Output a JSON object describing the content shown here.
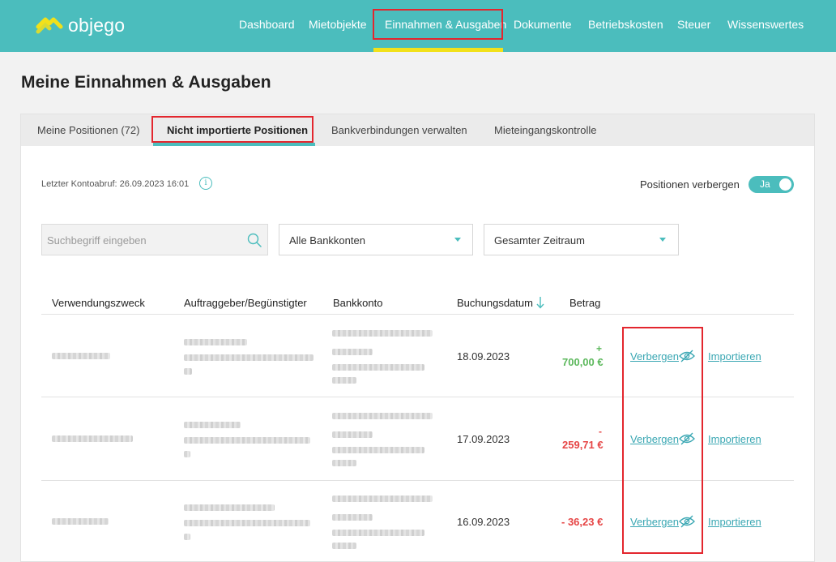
{
  "app": {
    "brand": "objego",
    "nav": [
      "Dashboard",
      "Mietobjekte",
      "Einnahmen & Ausgaben",
      "Dokumente",
      "Betriebskosten",
      "Steuer",
      "Wissenswertes"
    ],
    "active_nav": "Einnahmen & Ausgaben",
    "accent": "#4bbdbd",
    "highlight": "#f2e11a"
  },
  "page": {
    "title": "Meine Einnahmen & Ausgaben"
  },
  "tabs": [
    "Meine Positionen (72)",
    "Nicht importierte Positionen",
    "Bankverbindungen verwalten",
    "Mieteingangskontrolle"
  ],
  "toolbar": {
    "last_fetch": "Letzter Kontoabruf: 26.09.2023 16:01",
    "info_glyph": "i",
    "hide_label": "Positionen verbergen",
    "toggle_label": "Ja",
    "toggle_on": true
  },
  "filters": {
    "search_placeholder": "Suchbegriff eingeben",
    "bank_account": "Alle Bankkonten",
    "period": "Gesamter Zeitraum"
  },
  "table": {
    "headers": [
      "Verwendungszweck",
      "Auftraggeber/Begünstigter",
      "Bankkonto",
      "Buchungsdatum",
      "Betrag"
    ],
    "rows": [
      {
        "date": "18.09.2023",
        "sign": "+",
        "amount": "700,00 €",
        "type": "income",
        "hide": "Verbergen",
        "import": "Importieren"
      },
      {
        "date": "17.09.2023",
        "sign": "-",
        "amount": "259,71 €",
        "type": "expense",
        "hide": "Verbergen",
        "import": "Importieren"
      },
      {
        "date": "16.09.2023",
        "sign": "",
        "amount": "- 36,23 €",
        "type": "expense",
        "hide": "Verbergen",
        "import": "Importieren"
      }
    ]
  },
  "colors": {
    "income": "#5cb85c",
    "expense": "#e64545",
    "annotation": "#e3262e",
    "link": "#3aa7b3"
  }
}
